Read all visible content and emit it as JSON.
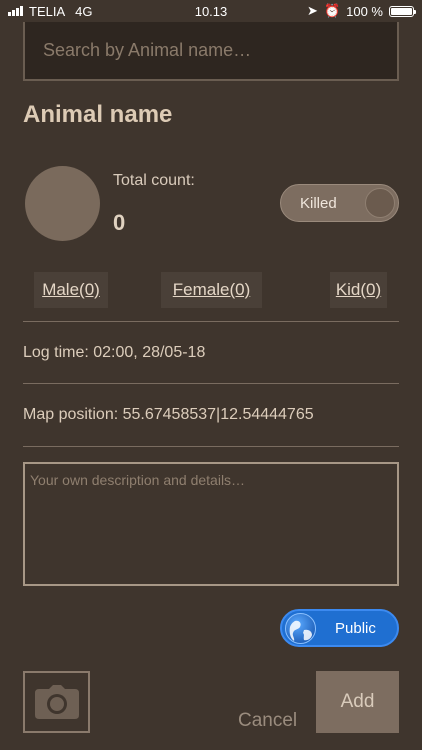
{
  "status_bar": {
    "carrier": "TELIA",
    "network": "4G",
    "time": "10.13",
    "battery": "100 %"
  },
  "search": {
    "placeholder": "Search by Animal name…"
  },
  "animal": {
    "title": "Animal name",
    "total_count_label": "Total count:",
    "total_count_value": "0",
    "killed_toggle_label": "Killed"
  },
  "gender": {
    "male": "Male(0)",
    "female": "Female(0)",
    "kid": "Kid(0)"
  },
  "log_time": "Log time: 02:00, 28/05-18",
  "map_position": "Map position: 55.67458537|12.54444765",
  "description": {
    "placeholder": "Your own description and details…"
  },
  "visibility_toggle_label": "Public",
  "actions": {
    "cancel": "Cancel",
    "add": "Add"
  },
  "colors": {
    "background": "#3f352d",
    "accent_public": "#1f6fd1",
    "button": "#7d6d60"
  }
}
